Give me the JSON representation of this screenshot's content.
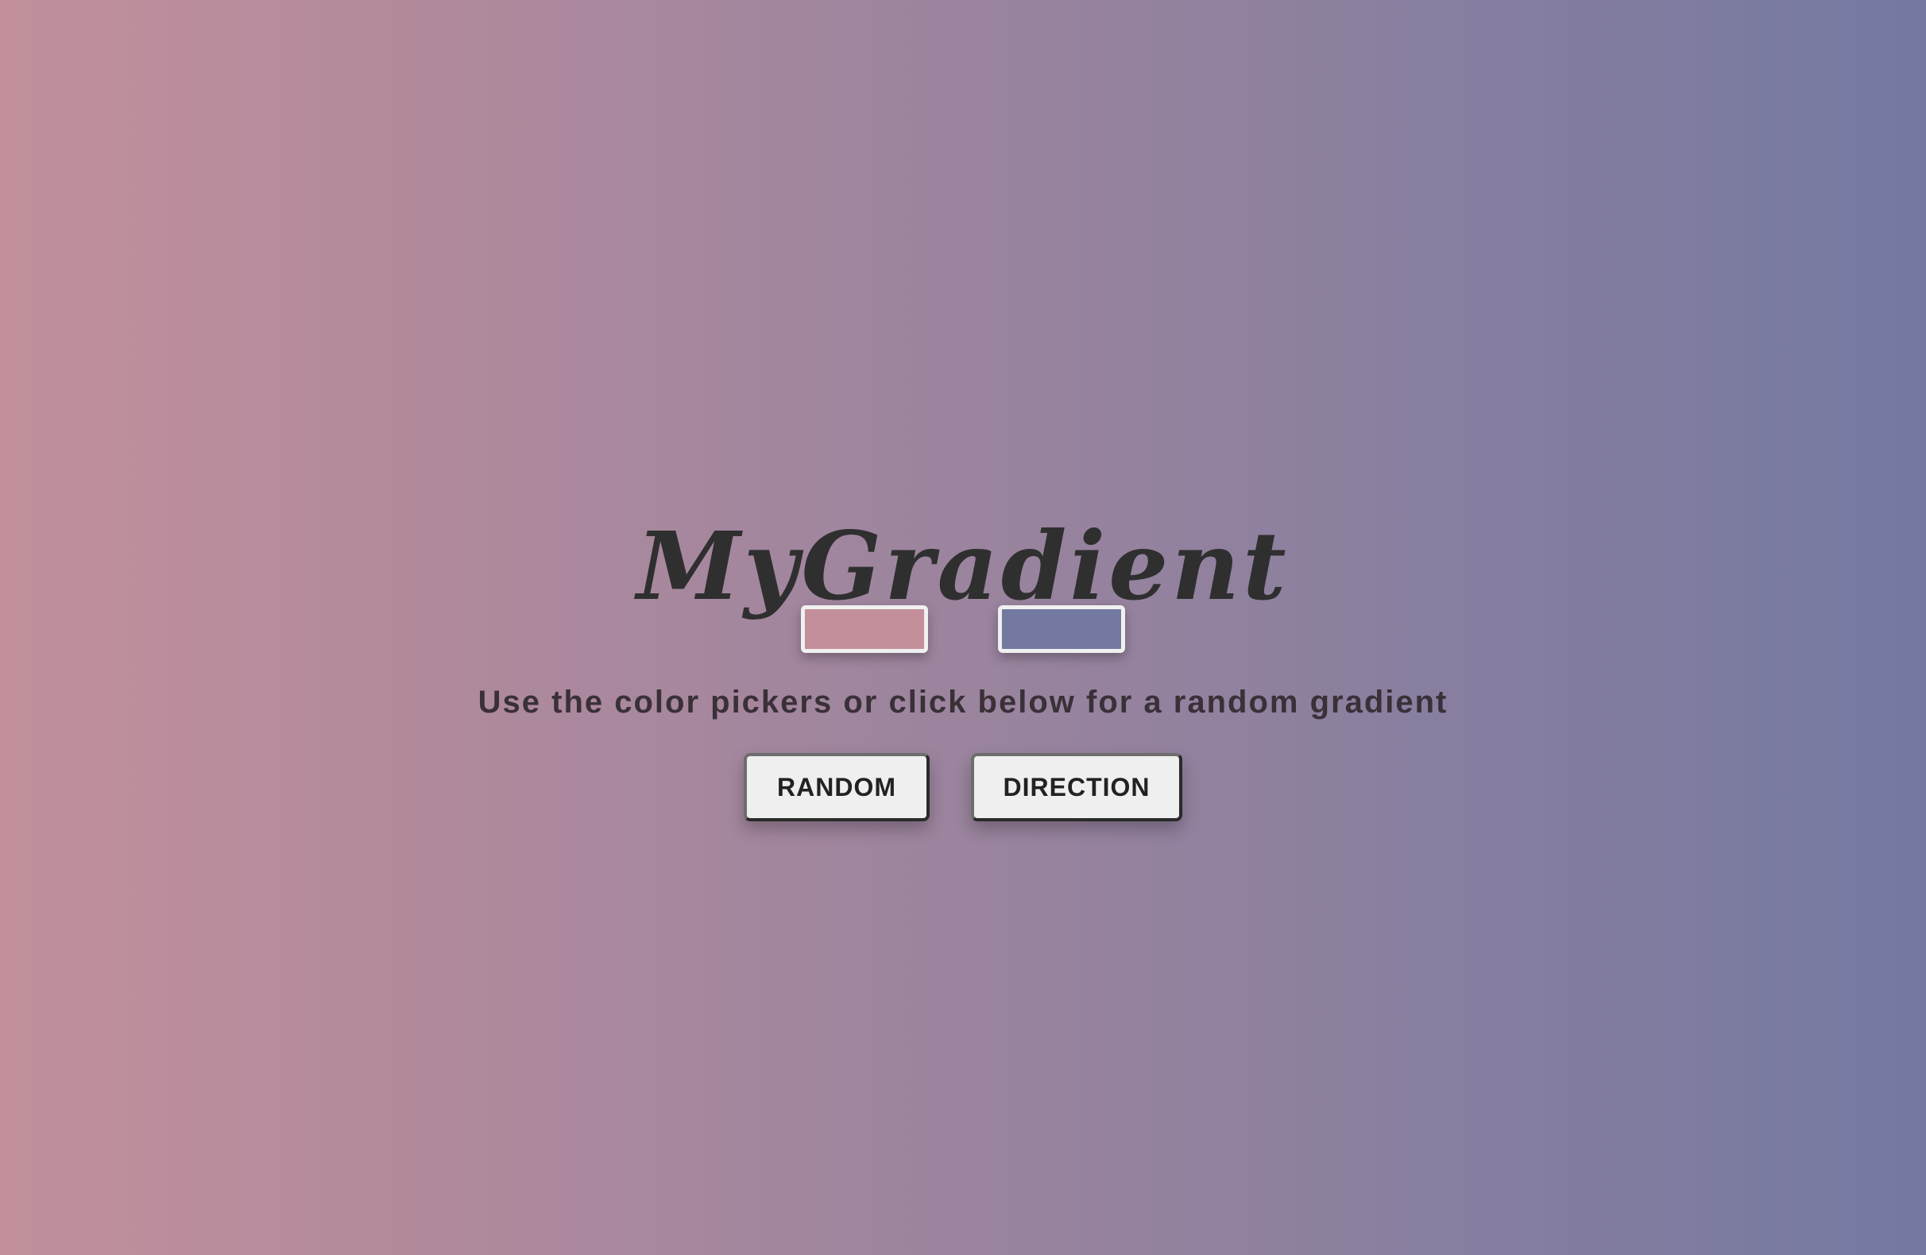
{
  "page": {
    "title": "MyGradient",
    "subtitle": "Use the color pickers or click below for a random gradient"
  },
  "colors": {
    "gradient_left": "#c28f9b",
    "gradient_right": "#7479a1",
    "picker_1": "#c28f9b",
    "picker_2": "#7479a1",
    "text": "#2f2f2f"
  },
  "buttons": {
    "random_label": "RANDOM",
    "direction_label": "DIRECTION"
  }
}
